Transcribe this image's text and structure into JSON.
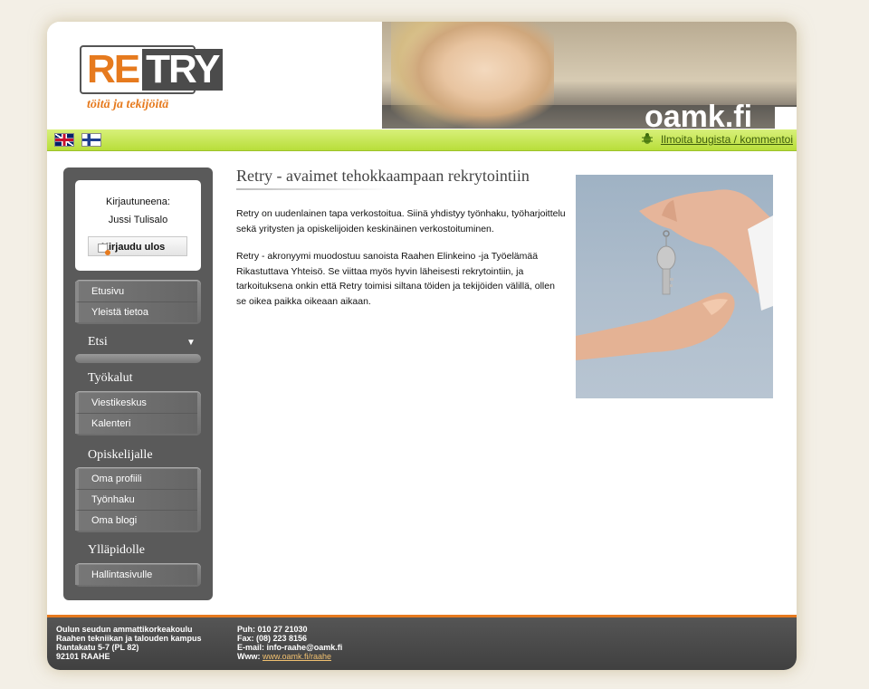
{
  "header": {
    "logo_re": "RE",
    "logo_try": "TRY",
    "slogan": "töitä ja tekijöitä",
    "oamk": "oamk.fi"
  },
  "toolbar": {
    "flags": [
      "english-flag",
      "finnish-flag"
    ],
    "bug_report_link": "Ilmoita bugista / kommentoi"
  },
  "sidebar": {
    "login_label": "Kirjautuneena:",
    "login_user": "Jussi Tulisalo",
    "logout_button": "Kirjaudu ulos",
    "main_menu": [
      "Etusivu",
      "Yleistä tietoa"
    ],
    "etsi_title": "Etsi",
    "tools_title": "Työkalut",
    "tools_menu": [
      "Viestikeskus",
      "Kalenteri"
    ],
    "students_title": "Opiskelijalle",
    "students_menu": [
      "Oma profiili",
      "Työnhaku",
      "Oma blogi"
    ],
    "admin_title": "Ylläpidolle",
    "admin_menu": [
      "Hallintasivulle"
    ]
  },
  "main": {
    "title": "Retry - avaimet tehokkaampaan rekrytointiin",
    "paragraph1": "Retry on uudenlainen tapa verkostoitua. Siinä yhdistyy työnhaku, työharjoittelu sekä yritysten ja opiskelijoiden keskinäinen verkostoituminen.",
    "paragraph2": "Retry - akronyymi muodostuu sanoista Raahen Elinkeino -ja Työelämää Rikastuttava Yhteisö. Se viittaa myös hyvin läheisesti rekrytointiin, ja tarkoituksena onkin että Retry toimisi siltana töiden ja tekijöiden välillä, ollen se oikea paikka oikeaan aikaan."
  },
  "footer": {
    "org_line1": "Oulun seudun ammattikorkeakoulu",
    "org_line2": "Raahen tekniikan ja talouden kampus",
    "org_line3": "Rantakatu 5-7 (PL 82)",
    "org_line4": "92101 RAAHE",
    "phone": "Puh: 010 27 21030",
    "fax": "Fax: (08) 223 8156",
    "email": "E-mail: info-raahe@oamk.fi",
    "www_label": "Www: ",
    "www_link": "www.oamk.fi/raahe"
  },
  "colors": {
    "accent_orange": "#e67a1e",
    "green_bar": "#c6e552",
    "sidebar_gray": "#5a5a5a"
  }
}
